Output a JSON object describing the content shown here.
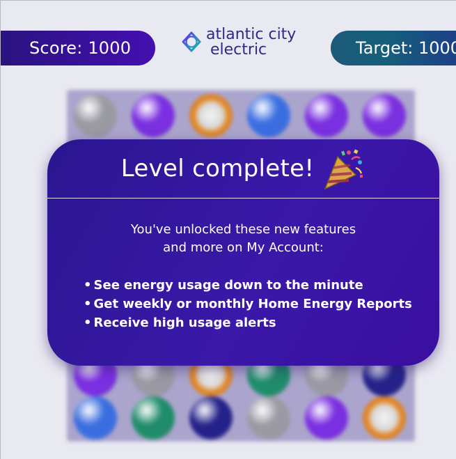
{
  "header": {
    "score_text": "Score: 1000",
    "target_text": "Target: 1000",
    "logo": {
      "line1": "atlantic city",
      "line2": "electric",
      "icon": "atlantic-city-electric-logo-icon"
    }
  },
  "board": {
    "rows": [
      [
        "silver",
        "purple",
        "orange",
        "blue",
        "purple",
        "purple"
      ],
      [
        "purple",
        "silver",
        "orange",
        "green",
        "silver",
        "navy"
      ],
      [
        "blue",
        "green",
        "navy",
        "silver",
        "purple",
        "orange"
      ]
    ],
    "visible_row_indices": [
      0,
      1,
      2
    ]
  },
  "gem_colors": {
    "silver": "#9a9aa4",
    "purple": "#7a2fe0",
    "orange": "#e58a2a",
    "blue": "#3a6ee0",
    "green": "#1f8c6a",
    "navy": "#24228a"
  },
  "modal": {
    "title": "Level complete!",
    "title_icon": "party-popper-icon",
    "intro_line1": "You've unlocked these new features",
    "intro_line2": "and more on My Account:",
    "features": [
      "See energy usage down to the minute",
      "Get weekly or monthly Home Energy Reports",
      "Receive high usage alerts"
    ]
  },
  "colors": {
    "background": "#e9e9f2",
    "score_pill": "#3312a0",
    "target_pill": "#1a5a7a",
    "modal": "#33169c",
    "logo_text": "#2f2a8a"
  }
}
